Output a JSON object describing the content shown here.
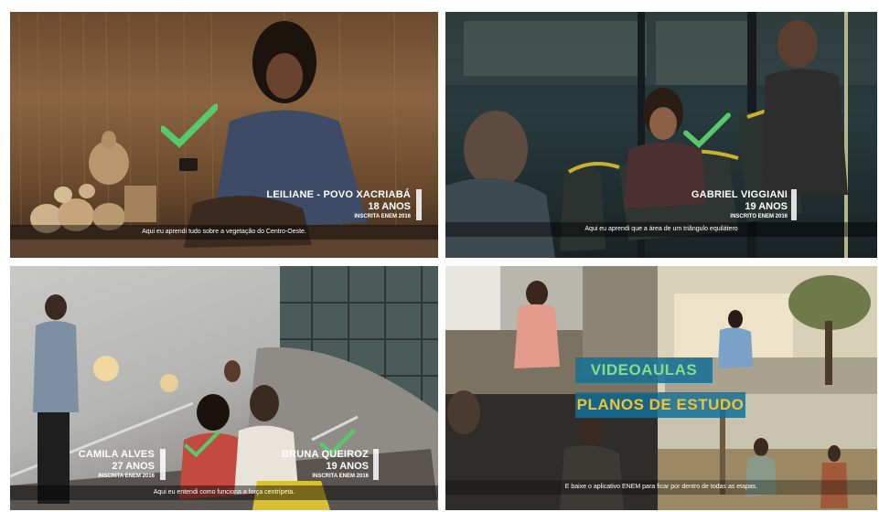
{
  "panels": [
    {
      "name": "LEILIANE - POVO XACRIABÁ",
      "age": "18 ANOS",
      "tag": "INSCRITA ENEM 2016",
      "subtitle": "Aqui eu aprendi tudo sobre a vegetação do Centro-Oeste."
    },
    {
      "name": "GABRIEL VIGGIANI",
      "age": "19 ANOS",
      "tag": "INSCRITO ENEM 2016",
      "subtitle": "Aqui eu aprendi que a área de um triângulo equilátero"
    },
    {
      "name_left": "CAMILA ALVES",
      "age_left": "27 ANOS",
      "tag_left": "INSCRITA ENEM 2016",
      "name_right": "BRUNA QUEIROZ",
      "age_right": "19 ANOS",
      "tag_right": "INSCRITA ENEM 2016",
      "subtitle": "Aqui eu entendi como funciona a força centrípeta."
    },
    {
      "promo_line1": "VIDEOAULAS",
      "promo_line2": "PLANOS DE ESTUDO",
      "subtitle": "E baixe o aplicativo ENEM para ficar por dentro de todas as etapas."
    }
  ],
  "colors": {
    "check": "#58c96b",
    "promo_line1": "#7fe08a",
    "promo_line2": "#f2c230",
    "promo_box": "#1d7fa6"
  },
  "icons": [
    "checkmark-icon"
  ]
}
